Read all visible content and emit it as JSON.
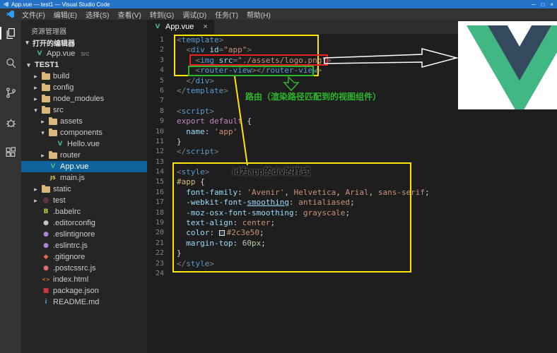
{
  "colors": {
    "titlebar_blue": "#2472c8",
    "selection_blue": "#0e639c",
    "vue_green": "#41b883",
    "vue_dark": "#35495e",
    "annotation_yellow": "#ffe400",
    "annotation_red": "#e62222",
    "annotation_green": "#2cb72c",
    "folder_tan": "#dcb67a"
  },
  "titlebar": {
    "title": "App.vue — test1 — Visual Studio Code",
    "controls": [
      "─",
      "□",
      "×"
    ]
  },
  "menubar": {
    "items": [
      "文件(F)",
      "编辑(E)",
      "选择(S)",
      "查看(V)",
      "转到(G)",
      "调试(D)",
      "任务(T)",
      "帮助(H)"
    ]
  },
  "activitybar": {
    "icons": [
      "explorer",
      "search",
      "source-control",
      "debug",
      "extensions"
    ]
  },
  "glyphs": {
    "chevron_down": "▾",
    "chevron_right": "▸"
  },
  "file_icons": {
    "vue": {
      "glyph": "V",
      "color": "#41b883"
    },
    "js": {
      "glyph": "JS",
      "color": "#e8d44d",
      "small": true
    },
    "test": {
      "glyph": "◎",
      "color": "#e06c75"
    },
    "babel": {
      "glyph": "B",
      "color": "#cbcb41"
    },
    "editorconfig": {
      "glyph": "●",
      "color": "#c5c5c5"
    },
    "eslint": {
      "glyph": "●",
      "color": "#b180d7"
    },
    "git": {
      "glyph": "◆",
      "color": "#e8694f"
    },
    "postcss": {
      "glyph": "●",
      "color": "#dd6e6e"
    },
    "html": {
      "glyph": "<>",
      "color": "#e37933",
      "small": true
    },
    "npm": {
      "glyph": "■",
      "color": "#cb3837"
    },
    "readme": {
      "glyph": "i",
      "color": "#519aba"
    }
  },
  "sidebar": {
    "title": "资源管理器",
    "open_editors": {
      "label": "打开的编辑器",
      "file": "App.vue",
      "suffix": "src"
    },
    "tree": [
      {
        "chev": "v",
        "icon": "",
        "label": "TEST1",
        "indent": 0,
        "root": true
      },
      {
        "chev": ">",
        "icon": "folder",
        "label": "build",
        "indent": 1
      },
      {
        "chev": ">",
        "icon": "folder",
        "label": "config",
        "indent": 1
      },
      {
        "chev": ">",
        "icon": "folder",
        "label": "node_modules",
        "indent": 1
      },
      {
        "chev": "v",
        "icon": "folder",
        "label": "src",
        "indent": 1
      },
      {
        "chev": ">",
        "icon": "folder",
        "label": "assets",
        "indent": 2
      },
      {
        "chev": "v",
        "icon": "folder",
        "label": "components",
        "indent": 2
      },
      {
        "chev": "",
        "icon": "vue",
        "label": "Hello.vue",
        "indent": 3
      },
      {
        "chev": ">",
        "icon": "folder",
        "label": "router",
        "indent": 2
      },
      {
        "chev": "",
        "icon": "vue",
        "label": "App.vue",
        "indent": 2,
        "selected": true
      },
      {
        "chev": "",
        "icon": "js",
        "label": "main.js",
        "indent": 2
      },
      {
        "chev": ">",
        "icon": "folder",
        "label": "static",
        "indent": 1
      },
      {
        "chev": ">",
        "icon": "test",
        "label": "test",
        "indent": 1
      },
      {
        "chev": "",
        "icon": "babel",
        "label": ".babelrc",
        "indent": 1
      },
      {
        "chev": "",
        "icon": "editorconfig",
        "label": ".editorconfig",
        "indent": 1
      },
      {
        "chev": "",
        "icon": "eslint",
        "label": ".eslintignore",
        "indent": 1
      },
      {
        "chev": "",
        "icon": "eslint",
        "label": ".eslintrc.js",
        "indent": 1
      },
      {
        "chev": "",
        "icon": "git",
        "label": ".gitignore",
        "indent": 1
      },
      {
        "chev": "",
        "icon": "postcss",
        "label": ".postcssrc.js",
        "indent": 1
      },
      {
        "chev": "",
        "icon": "html",
        "label": "index.html",
        "indent": 1
      },
      {
        "chev": "",
        "icon": "npm",
        "label": "package.json",
        "indent": 1
      },
      {
        "chev": "",
        "icon": "readme",
        "label": "README.md",
        "indent": 1
      }
    ]
  },
  "editor": {
    "tab": {
      "label": "App.vue",
      "close": "×"
    },
    "lines": [
      [
        [
          "pt",
          "<"
        ],
        [
          "tag",
          "template"
        ],
        [
          "pt",
          ">"
        ]
      ],
      [
        [
          "txt",
          "  "
        ],
        [
          "pt",
          "<"
        ],
        [
          "tag",
          "div"
        ],
        [
          "txt",
          " "
        ],
        [
          "attr",
          "id"
        ],
        [
          "pt",
          "="
        ],
        [
          "str",
          "\"app\""
        ],
        [
          "pt",
          ">"
        ]
      ],
      [
        [
          "txt",
          "    "
        ],
        [
          "pt",
          "<"
        ],
        [
          "tag",
          "img"
        ],
        [
          "txt",
          " "
        ],
        [
          "attr",
          "src"
        ],
        [
          "pt",
          "="
        ],
        [
          "str",
          "\"./assets/logo.png\""
        ],
        [
          "pt",
          ">"
        ]
      ],
      [
        [
          "txt",
          "    "
        ],
        [
          "pt",
          "<"
        ],
        [
          "tag",
          "router-view"
        ],
        [
          "pt",
          "></"
        ],
        [
          "tag",
          "router-view"
        ],
        [
          "pt",
          ">"
        ]
      ],
      [
        [
          "txt",
          "  "
        ],
        [
          "pt",
          "</"
        ],
        [
          "tag",
          "div"
        ],
        [
          "pt",
          ">"
        ]
      ],
      [
        [
          "pt",
          "</"
        ],
        [
          "tag",
          "template"
        ],
        [
          "pt",
          ">"
        ]
      ],
      [],
      [
        [
          "pt",
          "<"
        ],
        [
          "tag",
          "script"
        ],
        [
          "pt",
          ">"
        ]
      ],
      [
        [
          "kw",
          "export"
        ],
        [
          "txt",
          " "
        ],
        [
          "kw",
          "default"
        ],
        [
          "txt",
          " {"
        ]
      ],
      [
        [
          "txt",
          "  "
        ],
        [
          "attr",
          "name"
        ],
        [
          "txt",
          ": "
        ],
        [
          "str",
          "'app'"
        ]
      ],
      [
        [
          "txt",
          "}"
        ]
      ],
      [
        [
          "pt",
          "</"
        ],
        [
          "tag",
          "script"
        ],
        [
          "pt",
          ">"
        ]
      ],
      [],
      [
        [
          "pt",
          "<"
        ],
        [
          "tag",
          "style"
        ],
        [
          "pt",
          ">"
        ]
      ],
      [
        [
          "sel",
          "#app"
        ],
        [
          "txt",
          " {"
        ]
      ],
      [
        [
          "txt",
          "  "
        ],
        [
          "prop",
          "font-family"
        ],
        [
          "txt",
          ": "
        ],
        [
          "str",
          "'Avenir'"
        ],
        [
          "txt",
          ", "
        ],
        [
          "val",
          "Helvetica"
        ],
        [
          "txt",
          ", "
        ],
        [
          "val",
          "Arial"
        ],
        [
          "txt",
          ", "
        ],
        [
          "val",
          "sans-serif"
        ],
        [
          "txt",
          ";"
        ]
      ],
      [
        [
          "txt",
          "  "
        ],
        [
          "prop",
          "-webkit-font-"
        ],
        [
          "prop und",
          "smoothing"
        ],
        [
          "txt",
          ": "
        ],
        [
          "val",
          "antialiased"
        ],
        [
          "txt",
          ";"
        ]
      ],
      [
        [
          "txt",
          "  "
        ],
        [
          "prop",
          "-moz-osx-font-smoothing"
        ],
        [
          "txt",
          ": "
        ],
        [
          "val",
          "grayscale"
        ],
        [
          "txt",
          ";"
        ]
      ],
      [
        [
          "txt",
          "  "
        ],
        [
          "prop",
          "text-align"
        ],
        [
          "txt",
          ": "
        ],
        [
          "val",
          "center"
        ],
        [
          "txt",
          ";"
        ]
      ],
      [
        [
          "txt",
          "  "
        ],
        [
          "prop",
          "color"
        ],
        [
          "txt",
          ": "
        ],
        [
          "swatch",
          "#2c3e50"
        ],
        [
          "val",
          "#2c3e50"
        ],
        [
          "txt",
          ";"
        ]
      ],
      [
        [
          "txt",
          "  "
        ],
        [
          "prop",
          "margin-top"
        ],
        [
          "txt",
          ": "
        ],
        [
          "num",
          "60px"
        ],
        [
          "txt",
          ";"
        ]
      ],
      [
        [
          "txt",
          "}"
        ]
      ],
      [
        [
          "pt",
          "</"
        ],
        [
          "tag",
          "style"
        ],
        [
          "pt",
          ">"
        ]
      ],
      []
    ]
  },
  "annotations": {
    "route_note": "路由（渲染路径匹配到的视图组件）",
    "style_note": "id为app的div的样式"
  }
}
